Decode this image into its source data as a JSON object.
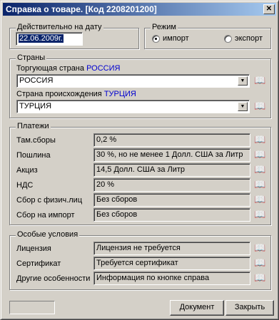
{
  "window": {
    "title": "Справка о товаре. [Код 2208201200]",
    "close_glyph": "✕"
  },
  "date_group": {
    "legend": "Действительно на дату",
    "date_value": "22.06.2009г."
  },
  "mode_group": {
    "legend": "Режим",
    "options": [
      {
        "label": "импорт",
        "checked": true
      },
      {
        "label": "экспорт",
        "checked": false
      }
    ]
  },
  "countries_group": {
    "legend": "Страны",
    "trading_label": "Торгующая страна",
    "trading_value_caption": "РОССИЯ",
    "trading_combo": "РОССИЯ",
    "origin_label": "Страна происхождения",
    "origin_value_caption": "ТУРЦИЯ",
    "origin_combo": "ТУРЦИЯ"
  },
  "payments_group": {
    "legend": "Платежи",
    "rows": [
      {
        "label": "Там.сборы",
        "value": "0,2 %",
        "book_enabled": true
      },
      {
        "label": "Пошлина",
        "value": "30 %, но не менее 1 Долл. США за Литр",
        "book_enabled": true
      },
      {
        "label": "Акциз",
        "value": "14,5 Долл. США за Литр",
        "book_enabled": true
      },
      {
        "label": "НДС",
        "value": "20 %",
        "book_enabled": true
      },
      {
        "label": "Сбор с физич.лиц",
        "value": "Без сборов",
        "book_enabled": true
      },
      {
        "label": "Сбор на импорт",
        "value": "Без сборов",
        "book_enabled": false
      }
    ]
  },
  "conditions_group": {
    "legend": "Особые условия",
    "rows": [
      {
        "label": "Лицензия",
        "value": "Лицензия не требуется"
      },
      {
        "label": "Сертификат",
        "value": "Требуется сертификат"
      },
      {
        "label": "Другие особенности",
        "value": "Информация по кнопке справа"
      }
    ]
  },
  "footer": {
    "document_button": "Документ",
    "close_button": "Закрыть"
  },
  "icons": {
    "book": "📖",
    "dropdown": "▼"
  },
  "colors": {
    "title_start": "#0a246a",
    "title_end": "#a6caf0",
    "face": "#d4d0c8",
    "caption_blue": "#0000d0"
  }
}
